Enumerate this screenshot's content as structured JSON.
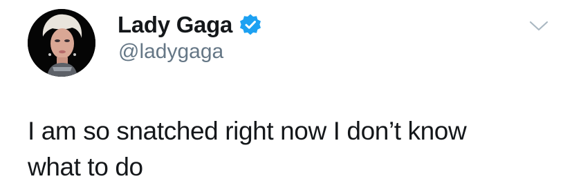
{
  "tweet": {
    "author": {
      "display_name": "Lady Gaga",
      "handle": "@ladygaga",
      "verified": true,
      "avatar_icon": "profile-photo"
    },
    "text_lines": [
      "I am so snatched right now I don’t know",
      "what to do"
    ],
    "menu_icon": "chevron-down-icon"
  },
  "colors": {
    "text": "#14171a",
    "handle": "#657786",
    "verified_blue": "#1da1f2",
    "caret": "#aab8c2"
  }
}
